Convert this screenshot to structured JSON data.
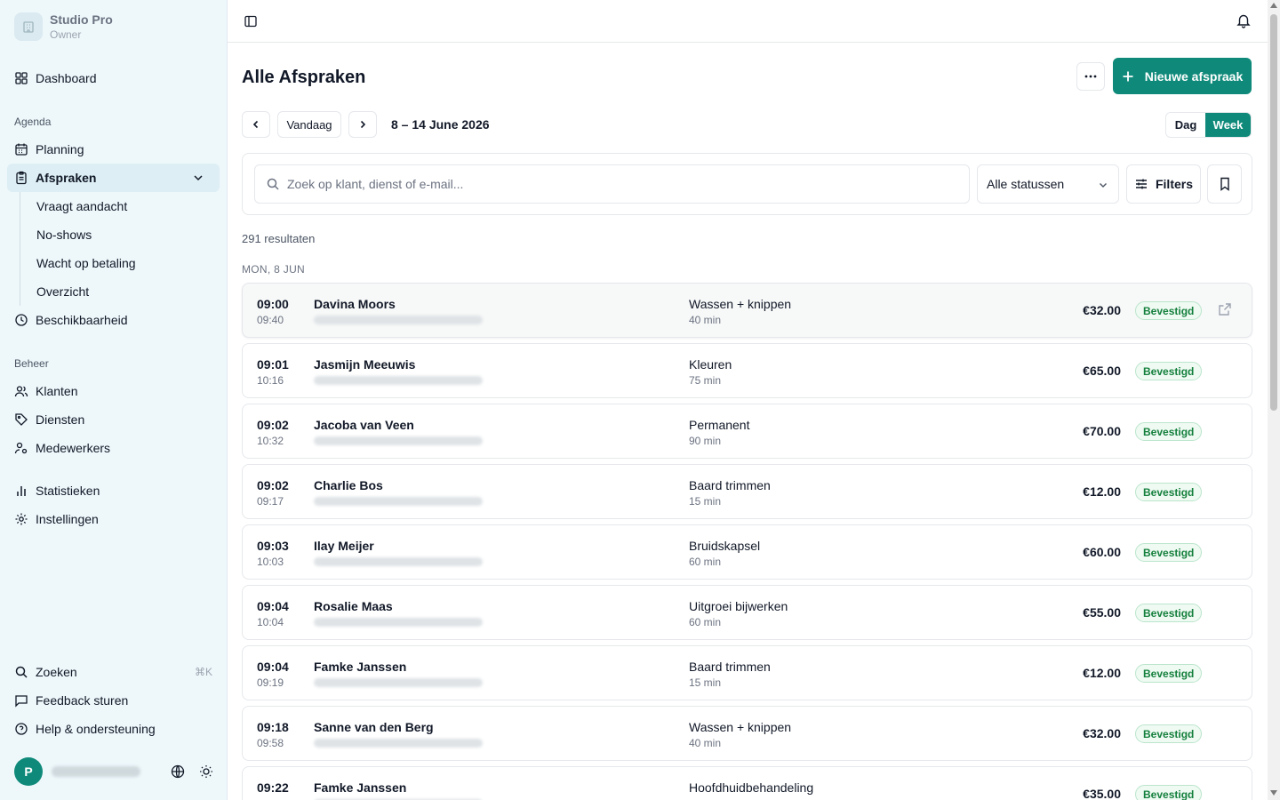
{
  "brand": {
    "name": "Studio Pro",
    "role": "Owner"
  },
  "sidebar": {
    "dashboard": "Dashboard",
    "section_agenda": "Agenda",
    "planning": "Planning",
    "afspraken": "Afspraken",
    "sub_items": [
      "Vraagt aandacht",
      "No-shows",
      "Wacht op betaling",
      "Overzicht"
    ],
    "beschikbaarheid": "Beschikbaarheid",
    "section_beheer": "Beheer",
    "klanten": "Klanten",
    "diensten": "Diensten",
    "medewerkers": "Medewerkers",
    "statistieken": "Statistieken",
    "instellingen": "Instellingen",
    "zoeken": "Zoeken",
    "zoeken_shortcut": "⌘K",
    "feedback": "Feedback sturen",
    "help": "Help & ondersteuning",
    "user_initial": "P"
  },
  "header": {
    "title": "Alle Afspraken",
    "new_button": "Nieuwe afspraak",
    "today_button": "Vandaag",
    "date_range": "8 – 14 June 2026",
    "view_day": "Dag",
    "view_week": "Week",
    "active_view": "Week"
  },
  "filters": {
    "search_placeholder": "Zoek op klant, dienst of e-mail...",
    "status_value": "Alle statussen",
    "filters_button": "Filters"
  },
  "results_count": "291 resultaten",
  "day_label": "MON, 8 JUN",
  "appointments": [
    {
      "start": "09:00",
      "end": "09:40",
      "name": "Davina Moors",
      "service": "Wassen + knippen",
      "duration": "40 min",
      "price": "€32.00",
      "status": "Bevestigd"
    },
    {
      "start": "09:01",
      "end": "10:16",
      "name": "Jasmijn Meeuwis",
      "service": "Kleuren",
      "duration": "75 min",
      "price": "€65.00",
      "status": "Bevestigd"
    },
    {
      "start": "09:02",
      "end": "10:32",
      "name": "Jacoba van Veen",
      "service": "Permanent",
      "duration": "90 min",
      "price": "€70.00",
      "status": "Bevestigd"
    },
    {
      "start": "09:02",
      "end": "09:17",
      "name": "Charlie Bos",
      "service": "Baard trimmen",
      "duration": "15 min",
      "price": "€12.00",
      "status": "Bevestigd"
    },
    {
      "start": "09:03",
      "end": "10:03",
      "name": "Ilay Meijer",
      "service": "Bruidskapsel",
      "duration": "60 min",
      "price": "€60.00",
      "status": "Bevestigd"
    },
    {
      "start": "09:04",
      "end": "10:04",
      "name": "Rosalie Maas",
      "service": "Uitgroei bijwerken",
      "duration": "60 min",
      "price": "€55.00",
      "status": "Bevestigd"
    },
    {
      "start": "09:04",
      "end": "09:19",
      "name": "Famke Janssen",
      "service": "Baard trimmen",
      "duration": "15 min",
      "price": "€12.00",
      "status": "Bevestigd"
    },
    {
      "start": "09:18",
      "end": "09:58",
      "name": "Sanne van den Berg",
      "service": "Wassen + knippen",
      "duration": "40 min",
      "price": "€32.00",
      "status": "Bevestigd"
    },
    {
      "start": "09:22",
      "end": "",
      "name": "Famke Janssen",
      "service": "Hoofdhuidbehandeling",
      "duration": "",
      "price": "€35.00",
      "status": "Bevestigd"
    }
  ],
  "colors": {
    "accent": "#0f8a7a",
    "sidebar_bg": "#eef8fb",
    "badge_text": "#15803d"
  }
}
